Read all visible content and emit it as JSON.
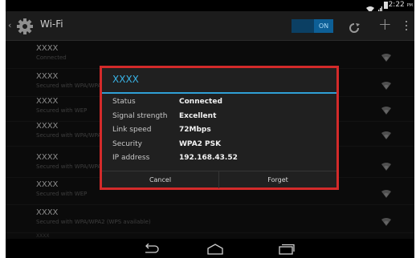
{
  "status_bar": {
    "time": "2:22",
    "time_suffix": "PM",
    "icons": [
      "wifi-icon",
      "signal-icon",
      "battery-icon"
    ]
  },
  "action_bar": {
    "title": "Wi-Fi",
    "toggle_state": "ON",
    "icons": [
      "settings-gear-icon",
      "wps-icon",
      "add-icon",
      "overflow-menu-icon"
    ]
  },
  "networks": [
    {
      "name": "XXXX",
      "status": "Connected"
    },
    {
      "name": "XXXX",
      "status": "Secured with WPA/WPA2 (WPS available)"
    },
    {
      "name": "XXXX",
      "status": "Secured with WEP"
    },
    {
      "name": "XXXX",
      "status": "Secured with WPA/WPA2 (WPS available)"
    },
    {
      "name": "XXXX",
      "status": "Secured with WPA/WPA2 (WPS available)"
    },
    {
      "name": "XXXX",
      "status": "Secured with WEP"
    },
    {
      "name": "XXXX",
      "status": "Secured with WPA/WPA2 (WPS available)"
    },
    {
      "name": "XXXX",
      "status": ""
    }
  ],
  "dialog": {
    "title": "XXXX",
    "rows": [
      {
        "label": "Status",
        "value": "Connected"
      },
      {
        "label": "Signal strength",
        "value": "Excellent"
      },
      {
        "label": "Link speed",
        "value": "72Mbps"
      },
      {
        "label": "Security",
        "value": "WPA2 PSK"
      },
      {
        "label": "IP address",
        "value": "192.168.43.52"
      }
    ],
    "cancel_label": "Cancel",
    "forget_label": "Forget",
    "highlight_color": "#d32a2a",
    "accent_color": "#39b3e6"
  },
  "nav_bar": {
    "icons": [
      "back-icon",
      "home-icon",
      "recents-icon"
    ]
  }
}
